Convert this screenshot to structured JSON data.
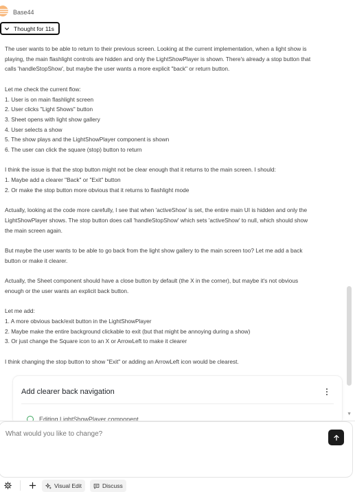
{
  "header": {
    "assistant_name": "Base44",
    "thought_label": "Thought for 11s"
  },
  "thought": {
    "paragraphs": [
      [
        "The user wants to be able to return to their previous screen. Looking at the current implementation, when a light show is",
        "playing, the main flashlight controls are hidden and only the LightShowPlayer is shown. There's already a stop button that",
        "calls 'handleStopShow', but maybe the user wants a more explicit \"back\" or return button."
      ],
      [
        "Let me check the current flow:",
        "1. User is on main flashlight screen",
        "2. User clicks \"Light Shows\" button",
        "3. Sheet opens with light show gallery",
        "4. User selects a show",
        "5. The show plays and the LightShowPlayer component is shown",
        "6. The user can click the square (stop) button to return"
      ],
      [
        "I think the issue is that the stop button might not be clear enough that it returns to the main screen. I should:",
        "1. Maybe add a clearer \"Back\" or \"Exit\" button",
        "2. Or make the stop button more obvious that it returns to flashlight mode"
      ],
      [
        "Actually, looking at the code more carefully, I see that when 'activeShow' is set, the entire main UI is hidden and only the",
        "LightShowPlayer shows. The stop button does call 'handleStopShow' which sets 'activeShow' to null, which should show",
        "the main screen again."
      ],
      [
        "But maybe the user wants to be able to go back from the light show gallery to the main screen too? Let me add a back",
        "button or make it clearer."
      ],
      [
        "Actually, the Sheet component should have a close button by default (the X in the corner), but maybe it's not obvious",
        "enough or the user wants an explicit back button."
      ],
      [
        "Let me add:",
        "1. A more obvious back/exit button in the LightShowPlayer",
        "2. Maybe make the entire background clickable to exit (but that might be annoying during a show)",
        "3. Or just change the Square icon to an X or ArrowLeft to make it clearer"
      ],
      [
        "I think changing the stop button to show \"Exit\" or adding an ArrowLeft icon would be clearest."
      ]
    ]
  },
  "card": {
    "title": "Add clearer back navigation",
    "step": "Editing LightShowPlayer component"
  },
  "composer": {
    "placeholder": "What would you like to change?"
  },
  "toolbar": {
    "visual_edit": "Visual Edit",
    "discuss": "Discuss"
  },
  "colors": {
    "send_button": "#1c1c1c",
    "avatar": "#f5a25d",
    "success": "#3aa55d"
  }
}
